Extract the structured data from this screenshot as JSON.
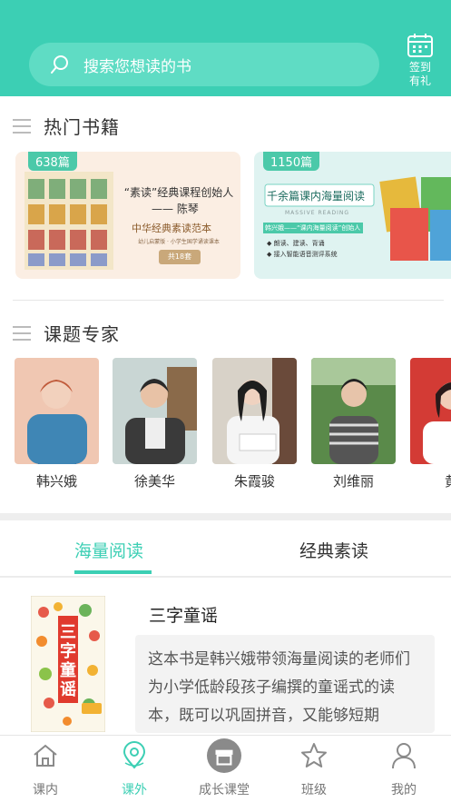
{
  "header": {
    "search_placeholder": "搜索您想读的书",
    "checkin_label": "签到有礼"
  },
  "sections": {
    "hot_books": "热门书籍",
    "experts": "课题专家"
  },
  "banners": [
    {
      "count": "638篇",
      "headline": "“素读”经典课程创始人",
      "author": "—— 陈琴",
      "subtitle": "中华经典素读范本",
      "note": "幼儿启蒙版 · 小学生国学诵读课本",
      "set_count": "共18套"
    },
    {
      "count": "1150篇",
      "headline": "千余篇课内海量阅读",
      "eng": "MASSIVE READING",
      "founder": "韩兴娥——“课内海量阅读”创始人",
      "bullet1": "◆ 朗读、建读、背诵",
      "bullet2": "◆ 接入智能语音测评系统"
    }
  ],
  "experts": [
    {
      "name": "韩兴娥"
    },
    {
      "name": "徐美华"
    },
    {
      "name": "朱霞骏"
    },
    {
      "name": "刘维丽"
    },
    {
      "name": "黄"
    }
  ],
  "tabs": {
    "active": "海量阅读",
    "inactive": "经典素读"
  },
  "book": {
    "title": "三字童谣",
    "cover_text": "三字童谣",
    "description": "这本书是韩兴娥带领海量阅读的老师们为小学低龄段孩子编撰的童谣式的读本，既可以巩固拼音，又能够短期"
  },
  "nav": [
    {
      "label": "课内",
      "icon": "house-icon"
    },
    {
      "label": "课外",
      "icon": "location-pin-icon"
    },
    {
      "label": "成长课堂",
      "icon": "store-icon"
    },
    {
      "label": "班级",
      "icon": "star-icon"
    },
    {
      "label": "我的",
      "icon": "person-icon"
    }
  ],
  "colors": {
    "accent": "#3ccfb4",
    "header_bg": "#3ccfb4",
    "inactive_text": "#777777"
  }
}
